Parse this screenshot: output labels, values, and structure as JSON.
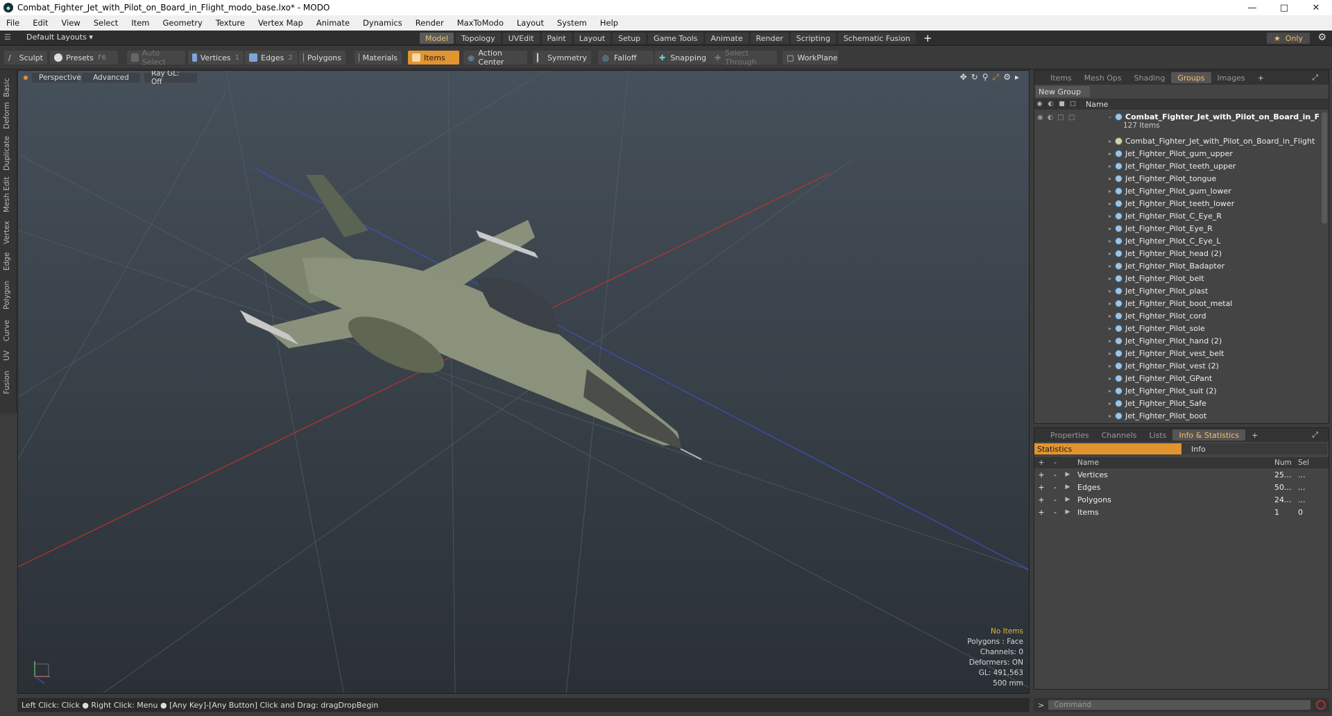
{
  "window": {
    "title": "Combat_Fighter_Jet_with_Pilot_on_Board_in_Flight_modo_base.lxo* - MODO",
    "min_icon": "minimize-icon",
    "max_icon": "maximize-icon",
    "close_icon": "close-icon"
  },
  "menu": [
    "File",
    "Edit",
    "View",
    "Select",
    "Item",
    "Geometry",
    "Texture",
    "Vertex Map",
    "Animate",
    "Dynamics",
    "Render",
    "MaxToModo",
    "Layout",
    "System",
    "Help"
  ],
  "layout_selector": "Default Layouts",
  "mode_tabs": [
    {
      "label": "Model",
      "active": true
    },
    {
      "label": "Topology"
    },
    {
      "label": "UVEdit"
    },
    {
      "label": "Paint"
    },
    {
      "label": "Layout"
    },
    {
      "label": "Setup"
    },
    {
      "label": "Game Tools"
    },
    {
      "label": "Animate"
    },
    {
      "label": "Render"
    },
    {
      "label": "Scripting"
    },
    {
      "label": "Schematic Fusion"
    }
  ],
  "only_label": "Only",
  "toolbar": {
    "sculpt": "Sculpt",
    "presets": "Presets",
    "presets_key": "F6",
    "auto_select": "Auto Select",
    "vertices": "Vertices",
    "vertices_key": "1",
    "edges": "Edges",
    "edges_key": "2",
    "polygons": "Polygons",
    "materials": "Materials",
    "items": "Items",
    "action_center": "Action Center",
    "symmetry": "Symmetry",
    "falloff": "Falloff",
    "snapping": "Snapping",
    "select_through": "Select Through",
    "workplane": "WorkPlane"
  },
  "left_tabs": [
    "Basic",
    "Deform",
    "Duplicate",
    "Mesh Edit",
    "Vertex",
    "Edge",
    "Polygon",
    "Curve",
    "UV",
    "Fusion"
  ],
  "viewport": {
    "view": "Perspective",
    "shading": "Advanced",
    "raygl": "Ray GL: Off",
    "info": {
      "no_items": "No Items",
      "polygons": "Polygons : Face",
      "channels": "Channels: 0",
      "deformers": "Deformers: ON",
      "gl": "GL: 491,563",
      "scale": "500 mm"
    }
  },
  "status_text": "Left Click: Click ● Right Click: Menu ● [Any Key]-[Any Button] Click and Drag: dragDropBegin",
  "groups_panel": {
    "tabs": [
      {
        "label": "Items"
      },
      {
        "label": "Mesh Ops"
      },
      {
        "label": "Shading"
      },
      {
        "label": "Groups",
        "active": true
      },
      {
        "label": "Images"
      }
    ],
    "new_group": "New Group",
    "col_name": "Name",
    "root_name": "Combat_Fighter_Jet_with_Pilot_on_Board_in_F...",
    "root_count": "127 Items",
    "items": [
      "Combat_Fighter_Jet_with_Pilot_on_Board_in_Flight",
      "Jet_Fighter_Pilot_gum_upper",
      "Jet_Fighter_Pilot_teeth_upper",
      "Jet_Fighter_Pilot_tongue",
      "Jet_Fighter_Pilot_gum_lower",
      "Jet_Fighter_Pilot_teeth_lower",
      "Jet_Fighter_Pilot_C_Eye_R",
      "Jet_Fighter_Pilot_Eye_R",
      "Jet_Fighter_Pilot_C_Eye_L",
      "Jet_Fighter_Pilot_head (2)",
      "Jet_Fighter_Pilot_Badapter",
      "Jet_Fighter_Pilot_belt",
      "Jet_Fighter_Pilot_plast",
      "Jet_Fighter_Pilot_boot_metal",
      "Jet_Fighter_Pilot_cord",
      "Jet_Fighter_Pilot_sole",
      "Jet_Fighter_Pilot_hand (2)",
      "Jet_Fighter_Pilot_vest_belt",
      "Jet_Fighter_Pilot_vest (2)",
      "Jet_Fighter_Pilot_GPant",
      "Jet_Fighter_Pilot_suit (2)",
      "Jet_Fighter_Pilot_Safe",
      "Jet_Fighter_Pilot_boot"
    ]
  },
  "stats_panel": {
    "tabs": [
      {
        "label": "Properties"
      },
      {
        "label": "Channels"
      },
      {
        "label": "Lists"
      },
      {
        "label": "Info & Statistics",
        "active": true
      }
    ],
    "statistics": "Statistics",
    "info": "Info",
    "cols": {
      "name": "Name",
      "num": "Num",
      "sel": "Sel"
    },
    "rows": [
      {
        "name": "Vertices",
        "num": "25...",
        "sel": "..."
      },
      {
        "name": "Edges",
        "num": "50...",
        "sel": "..."
      },
      {
        "name": "Polygons",
        "num": "24...",
        "sel": "..."
      },
      {
        "name": "Items",
        "num": "1",
        "sel": "0"
      }
    ]
  },
  "command_placeholder": "Command",
  "colors": {
    "accent": "#e29430",
    "active_text": "#f0c070"
  }
}
